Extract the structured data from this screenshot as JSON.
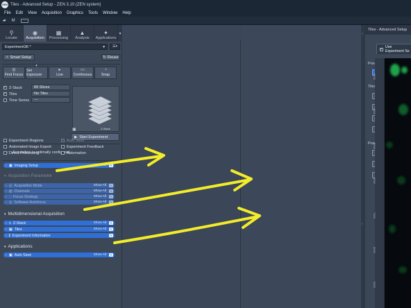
{
  "window": {
    "title": "Tiles - Advanced Setup - ZEN 3.10 (ZEN system)",
    "logo": "ZEN",
    "menus": [
      "File",
      "Edit",
      "View",
      "Acquisition",
      "Graphics",
      "Tools",
      "Window",
      "Help"
    ],
    "toolbar": {
      "mode_label": "M",
      "more_label": "···"
    }
  },
  "left_panel": {
    "tabs": [
      {
        "label": "Locate",
        "icon": "locate-icon"
      },
      {
        "label": "Acquisition",
        "icon": "camera-icon"
      },
      {
        "label": "Processing",
        "icon": "processing-icon"
      },
      {
        "label": "Analysis",
        "icon": "analysis-icon"
      },
      {
        "label": "Applications",
        "icon": "applications-icon"
      }
    ],
    "active_tab": "Acquisition",
    "experiment": {
      "name": "Experiment36 *",
      "smart_setup": "Smart Setup",
      "reuse": "Reuse"
    },
    "controls": [
      "Find Focus",
      "Set Exposure",
      "Live",
      "Continuous",
      "Snap"
    ],
    "dimensions": [
      {
        "label": "Z-Stack",
        "checked": true,
        "value": "89 Slices"
      },
      {
        "label": "Tiles",
        "checked": true,
        "value": "No Tiles"
      },
      {
        "label": "Time Series",
        "checked": false,
        "value": "---"
      }
    ],
    "preview_caption": "Z-Stack",
    "start_experiment": "Start Experiment",
    "status_message": "Acquisition is optimally configured.",
    "options": [
      {
        "label": "Experiment Regions",
        "checked": false,
        "dim": false
      },
      {
        "label": "Auto Save",
        "checked": true,
        "dim": true
      },
      {
        "label": "Automated Image Export",
        "checked": false,
        "dim": false
      },
      {
        "label": "Experiment Feedback",
        "checked": false,
        "dim": false
      },
      {
        "label": "Direct Processing",
        "checked": false,
        "dim": false
      },
      {
        "label": "Automation",
        "checked": false,
        "dim": false
      }
    ],
    "imaging_setup": {
      "label": "Imaging Setup",
      "show_all": "Show All"
    },
    "acq_header": "Acquisition Parameter",
    "acq_items": [
      {
        "label": "Acquisition Mode",
        "show_all": "Show All"
      },
      {
        "label": "Channels",
        "show_all": "Show All"
      },
      {
        "label": "Focus Strategy",
        "show_all": "Show All"
      },
      {
        "label": "Software Autofocus",
        "show_all": "Show All"
      }
    ],
    "multi_header": "Multidimensional Acquisition",
    "multi_items": [
      {
        "label": "Z-Stack",
        "show_all": "Show All"
      },
      {
        "label": "Tiles",
        "show_all": "Show All"
      },
      {
        "label": "Experiment Information",
        "show_all": ""
      }
    ],
    "apps_header": "Applications",
    "apps_items": [
      {
        "label": "Auto Save",
        "show_all": "Show All"
      }
    ]
  },
  "tiles_panel": {
    "title": "Tiles - Advanced Setup",
    "use_experiment": "Use Experiment Se",
    "preview_label": "Preview",
    "tiles_label": "Tiles",
    "positions_label": "Positions",
    "ruler_ticks": [
      "3000",
      "4000",
      "5000",
      "6000",
      "7000",
      "8000",
      "9000"
    ]
  },
  "colors": {
    "accent": "#2f6fd6",
    "arrow": "#f3ec2a",
    "titlebar": "#1c2736",
    "panel": "#3c4758"
  }
}
